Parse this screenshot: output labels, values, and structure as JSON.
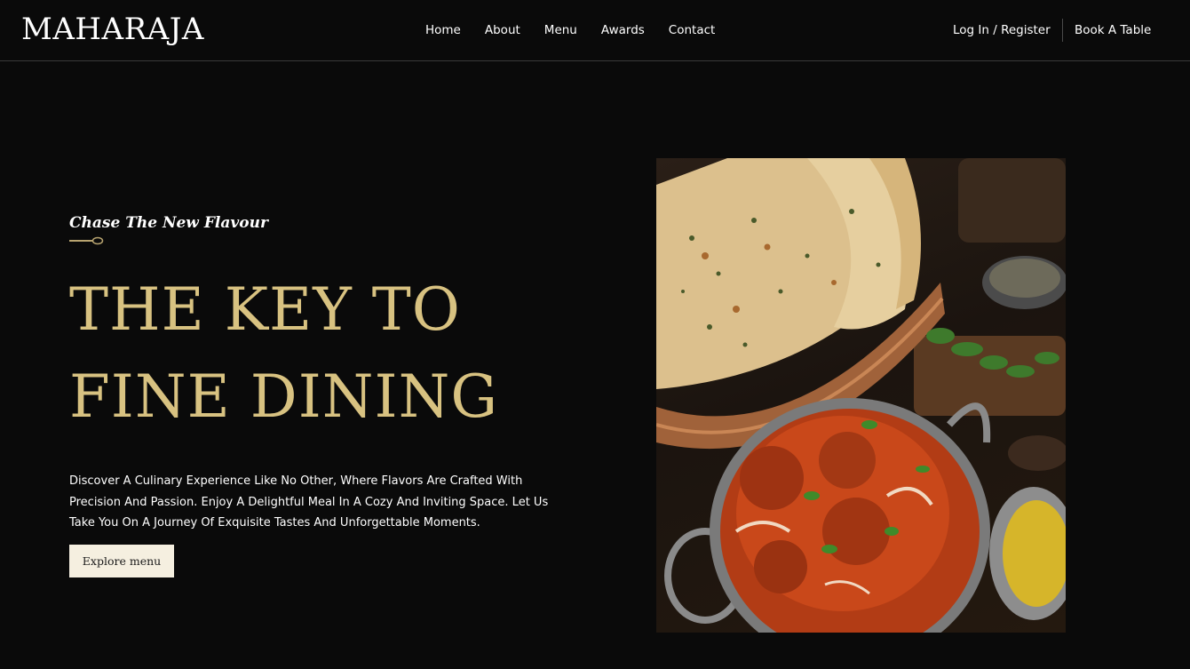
{
  "header": {
    "logo": "MAHARAJA",
    "nav": [
      "Home",
      "About",
      "Menu",
      "Awards",
      "Contact"
    ],
    "auth_label": "Log In / Register",
    "book_label": "Book A Table"
  },
  "hero": {
    "eyebrow": "Chase The New Flavour",
    "headline_line1": "THE KEY TO",
    "headline_line2": "FINE DINING",
    "description": "Discover A Culinary Experience Like No Other, Where Flavors Are Crafted With Precision And Passion. Enjoy A Delightful Meal In A Cozy And Inviting Space. Let Us Take You On A Journey Of Exquisite Tastes And Unforgettable Moments.",
    "cta_label": "Explore menu"
  },
  "colors": {
    "background": "#0a0a0a",
    "accent_gold": "#d8c281",
    "button_bg": "#f5efe0"
  }
}
